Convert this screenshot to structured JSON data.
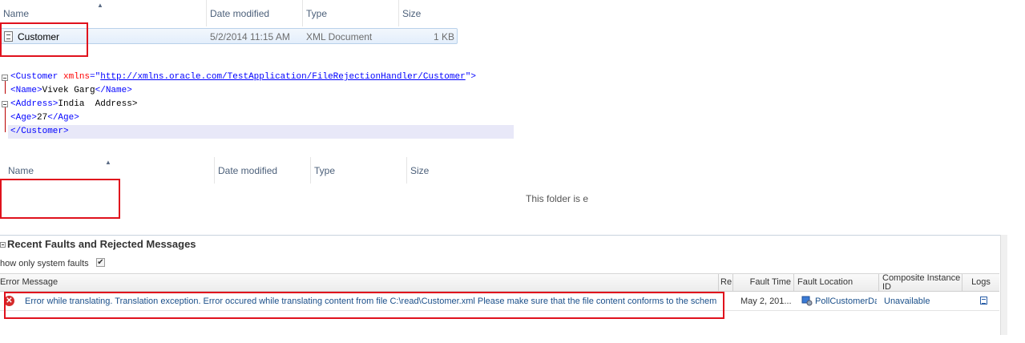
{
  "explorer_top": {
    "columns": [
      "Name",
      "Date modified",
      "Type",
      "Size"
    ],
    "file": {
      "name": "Customer",
      "date": "5/2/2014 11:15 AM",
      "type": "XML Document",
      "size": "1 KB"
    }
  },
  "xml": {
    "line1": {
      "open": "<Customer ",
      "attr": "xmlns",
      "eq": "=\"",
      "url": "http://xmlns.oracle.com/TestApplication/FileRejectionHandler/Customer",
      "close": "\">"
    },
    "line2": {
      "open": "<Name>",
      "text": "Vivek Garg",
      "close": "</Name>"
    },
    "line3": {
      "open": "<Address>",
      "text": "India  Address>"
    },
    "line4": {
      "open": "<Age>",
      "text": "27",
      "close": "</Age>"
    },
    "line5": "</Customer>"
  },
  "explorer_bottom": {
    "columns": [
      "Name",
      "Date modified",
      "Type",
      "Size"
    ],
    "empty_message": "This folder is e"
  },
  "faults": {
    "title": "Recent Faults and Rejected Messages",
    "filter_label": "how only system faults",
    "filter_checked": "✔",
    "columns": {
      "error_message": "Error Message",
      "re": "Re",
      "fault_time": "Fault Time",
      "fault_location": "Fault Location",
      "composite_instance_id": "Composite Instance ID",
      "logs": "Logs"
    },
    "row": {
      "error_message": "Error while translating. Translation exception. Error occured while translating content from file C:\\read\\Customer.xml Please make sure that the file content conforms to the schema",
      "fault_time": "May 2, 201...",
      "fault_location": "PollCustomerDa",
      "composite_instance_id": "Unavailable"
    }
  },
  "colors": {
    "annotation_red": "#e0121d",
    "link_blue": "#1a4f8a",
    "error_red": "#d42a2a"
  },
  "icons": [
    "sort-up-icon",
    "xml-file-icon",
    "collapse-icon",
    "error-icon",
    "service-icon",
    "log-icon",
    "checkbox-icon"
  ]
}
